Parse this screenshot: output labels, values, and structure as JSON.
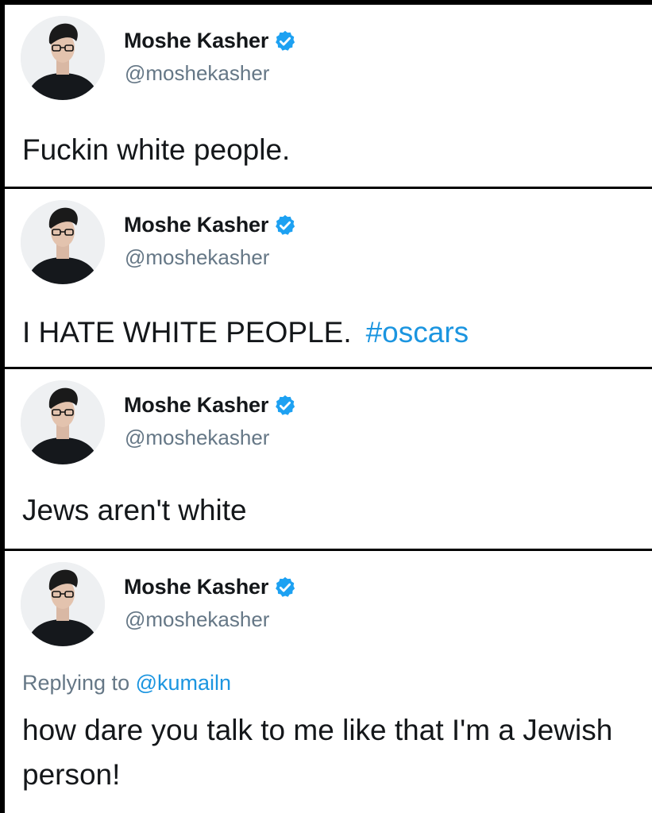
{
  "tweets": [
    {
      "author": "Moshe Kasher",
      "handle": "@moshekasher",
      "text": "Fuckin white people."
    },
    {
      "author": "Moshe Kasher",
      "handle": "@moshekasher",
      "text": "I HATE WHITE PEOPLE.",
      "hashtag": "#oscars"
    },
    {
      "author": "Moshe Kasher",
      "handle": "@moshekasher",
      "text": "Jews aren't white"
    },
    {
      "author": "Moshe Kasher",
      "handle": "@moshekasher",
      "replying_to_label": "Replying to",
      "replying_to_handle": "@kumailn",
      "text": "how dare you talk to me like that I'm a Jewish person!"
    }
  ],
  "colors": {
    "link": "#1b95e0",
    "secondary_text": "#657786",
    "verified_badge": "#1da1f2"
  },
  "icons": {
    "verified": "verified-badge-icon"
  }
}
